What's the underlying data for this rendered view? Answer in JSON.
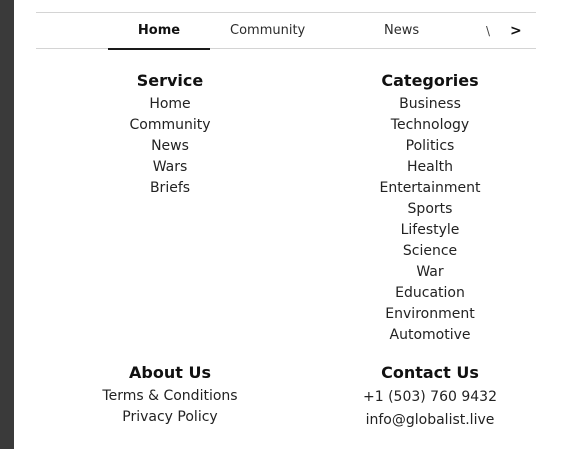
{
  "tabs": {
    "home": "Home",
    "community": "Community",
    "news": "News",
    "more": "\\",
    "next": ">"
  },
  "service": {
    "title": "Service",
    "items": [
      "Home",
      "Community",
      "News",
      "Wars",
      "Briefs"
    ]
  },
  "categories": {
    "title": "Categories",
    "items": [
      "Business",
      "Technology",
      "Politics",
      "Health",
      "Entertainment",
      "Sports",
      "Lifestyle",
      "Science",
      "War",
      "Education",
      "Environment",
      "Automotive"
    ]
  },
  "about": {
    "title": "About Us",
    "items": [
      "Terms & Conditions",
      "Privacy Policy"
    ]
  },
  "contact": {
    "title": "Contact Us",
    "phone": "+1 (503) 760 9432",
    "email": "info@globalist.live"
  }
}
